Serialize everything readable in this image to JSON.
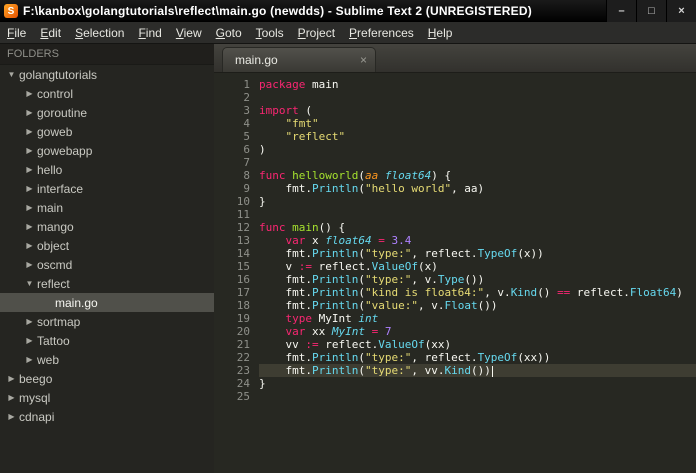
{
  "window": {
    "title": "F:\\kanbox\\golangtutorials\\reflect\\main.go (newdds) - Sublime Text 2 (UNREGISTERED)",
    "app_icon_letter": "S",
    "minimize": "–",
    "maximize": "□",
    "close": "×"
  },
  "menu": {
    "items": [
      "File",
      "Edit",
      "Selection",
      "Find",
      "View",
      "Goto",
      "Tools",
      "Project",
      "Preferences",
      "Help"
    ]
  },
  "sidebar": {
    "header": "FOLDERS",
    "items": [
      {
        "label": "golangtutorials",
        "level": 0,
        "state": "open"
      },
      {
        "label": "control",
        "level": 1,
        "state": "closed"
      },
      {
        "label": "goroutine",
        "level": 1,
        "state": "closed"
      },
      {
        "label": "goweb",
        "level": 1,
        "state": "closed"
      },
      {
        "label": "gowebapp",
        "level": 1,
        "state": "closed"
      },
      {
        "label": "hello",
        "level": 1,
        "state": "closed"
      },
      {
        "label": "interface",
        "level": 1,
        "state": "closed"
      },
      {
        "label": "main",
        "level": 1,
        "state": "closed"
      },
      {
        "label": "mango",
        "level": 1,
        "state": "closed"
      },
      {
        "label": "object",
        "level": 1,
        "state": "closed"
      },
      {
        "label": "oscmd",
        "level": 1,
        "state": "closed"
      },
      {
        "label": "reflect",
        "level": 1,
        "state": "open"
      },
      {
        "label": "main.go",
        "level": 2,
        "state": "file",
        "selected": true
      },
      {
        "label": "sortmap",
        "level": 1,
        "state": "closed"
      },
      {
        "label": "Tattoo",
        "level": 1,
        "state": "closed"
      },
      {
        "label": "web",
        "level": 1,
        "state": "closed"
      },
      {
        "label": "beego",
        "level": 0,
        "state": "closed"
      },
      {
        "label": "mysql",
        "level": 0,
        "state": "closed"
      },
      {
        "label": "cdnapi",
        "level": 0,
        "state": "closed"
      }
    ]
  },
  "tabs": [
    {
      "label": "main.go",
      "close": "×"
    }
  ],
  "colors": {
    "kw": "#f92672",
    "str": "#e6db74",
    "fn": "#a6e22e",
    "typ": "#66d9ef",
    "call": "#66d9ef",
    "num": "#ae81ff",
    "arg": "#fd971f",
    "pl": "#f8f8f2",
    "editor_bg": "#272822",
    "current_line_bg": "#3e3d32"
  },
  "editor": {
    "current_line": 23,
    "lines": [
      [
        [
          "kw",
          "package"
        ],
        [
          "pl",
          " main"
        ]
      ],
      [],
      [
        [
          "kw",
          "import"
        ],
        [
          "pl",
          " ("
        ]
      ],
      [
        [
          "pl",
          "    "
        ],
        [
          "str",
          "\"fmt\""
        ]
      ],
      [
        [
          "pl",
          "    "
        ],
        [
          "str",
          "\"reflect\""
        ]
      ],
      [
        [
          "pl",
          ")"
        ]
      ],
      [],
      [
        [
          "kw",
          "func"
        ],
        [
          "pl",
          " "
        ],
        [
          "fn",
          "helloworld"
        ],
        [
          "pl",
          "("
        ],
        [
          "arg",
          "aa"
        ],
        [
          "pl",
          " "
        ],
        [
          "typ",
          "float64"
        ],
        [
          "pl",
          ") {"
        ]
      ],
      [
        [
          "pl",
          "    fmt."
        ],
        [
          "call",
          "Println"
        ],
        [
          "pl",
          "("
        ],
        [
          "str",
          "\"hello world\""
        ],
        [
          "pl",
          ", aa)"
        ]
      ],
      [
        [
          "pl",
          "}"
        ]
      ],
      [],
      [
        [
          "kw",
          "func"
        ],
        [
          "pl",
          " "
        ],
        [
          "fn",
          "main"
        ],
        [
          "pl",
          "() {"
        ]
      ],
      [
        [
          "pl",
          "    "
        ],
        [
          "kw",
          "var"
        ],
        [
          "pl",
          " x "
        ],
        [
          "typ",
          "float64"
        ],
        [
          "pl",
          " "
        ],
        [
          "kw",
          "="
        ],
        [
          "pl",
          " "
        ],
        [
          "num",
          "3.4"
        ]
      ],
      [
        [
          "pl",
          "    fmt."
        ],
        [
          "call",
          "Println"
        ],
        [
          "pl",
          "("
        ],
        [
          "str",
          "\"type:\""
        ],
        [
          "pl",
          ", reflect."
        ],
        [
          "call",
          "TypeOf"
        ],
        [
          "pl",
          "(x))"
        ]
      ],
      [
        [
          "pl",
          "    v "
        ],
        [
          "kw",
          ":="
        ],
        [
          "pl",
          " reflect."
        ],
        [
          "call",
          "ValueOf"
        ],
        [
          "pl",
          "(x)"
        ]
      ],
      [
        [
          "pl",
          "    fmt."
        ],
        [
          "call",
          "Println"
        ],
        [
          "pl",
          "("
        ],
        [
          "str",
          "\"type:\""
        ],
        [
          "pl",
          ", v."
        ],
        [
          "call",
          "Type"
        ],
        [
          "pl",
          "())"
        ]
      ],
      [
        [
          "pl",
          "    fmt."
        ],
        [
          "call",
          "Println"
        ],
        [
          "pl",
          "("
        ],
        [
          "str",
          "\"kind is float64:\""
        ],
        [
          "pl",
          ", v."
        ],
        [
          "call",
          "Kind"
        ],
        [
          "pl",
          "() "
        ],
        [
          "kw",
          "=="
        ],
        [
          "pl",
          " reflect."
        ],
        [
          "call",
          "Float64"
        ],
        [
          "pl",
          ")"
        ]
      ],
      [
        [
          "pl",
          "    fmt."
        ],
        [
          "call",
          "Println"
        ],
        [
          "pl",
          "("
        ],
        [
          "str",
          "\"value:\""
        ],
        [
          "pl",
          ", v."
        ],
        [
          "call",
          "Float"
        ],
        [
          "pl",
          "())"
        ]
      ],
      [
        [
          "pl",
          "    "
        ],
        [
          "kw",
          "type"
        ],
        [
          "pl",
          " MyInt "
        ],
        [
          "typ",
          "int"
        ]
      ],
      [
        [
          "pl",
          "    "
        ],
        [
          "kw",
          "var"
        ],
        [
          "pl",
          " xx "
        ],
        [
          "typ",
          "MyInt"
        ],
        [
          "pl",
          " "
        ],
        [
          "kw",
          "="
        ],
        [
          "pl",
          " "
        ],
        [
          "num",
          "7"
        ]
      ],
      [
        [
          "pl",
          "    vv "
        ],
        [
          "kw",
          ":="
        ],
        [
          "pl",
          " reflect."
        ],
        [
          "call",
          "ValueOf"
        ],
        [
          "pl",
          "(xx)"
        ]
      ],
      [
        [
          "pl",
          "    fmt."
        ],
        [
          "call",
          "Println"
        ],
        [
          "pl",
          "("
        ],
        [
          "str",
          "\"type:\""
        ],
        [
          "pl",
          ", reflect."
        ],
        [
          "call",
          "TypeOf"
        ],
        [
          "pl",
          "(xx))"
        ]
      ],
      [
        [
          "pl",
          "    fmt."
        ],
        [
          "call",
          "Println"
        ],
        [
          "pl",
          "("
        ],
        [
          "str",
          "\"type:\""
        ],
        [
          "pl",
          ", vv."
        ],
        [
          "call",
          "Kind"
        ],
        [
          "pl",
          "())"
        ]
      ],
      [
        [
          "pl",
          "}"
        ]
      ],
      []
    ]
  }
}
